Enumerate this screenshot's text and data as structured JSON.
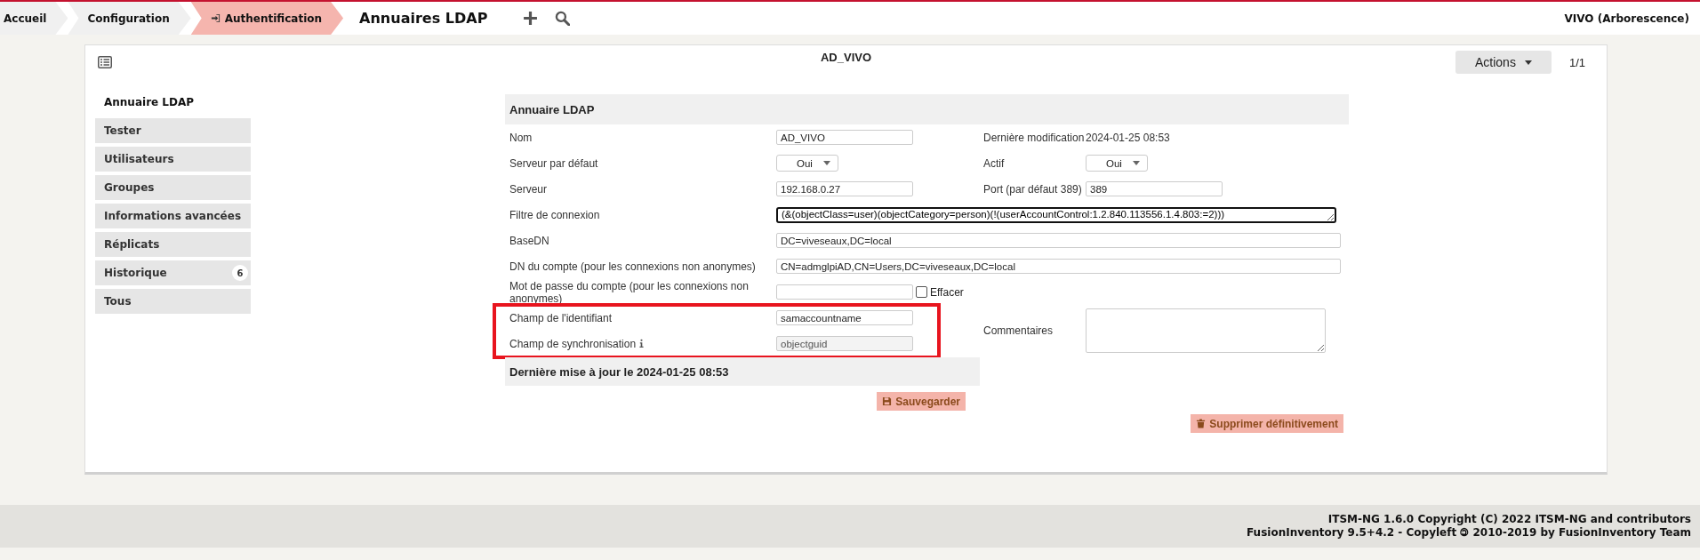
{
  "breadcrumbs": [
    {
      "label": "Accueil",
      "selected": false
    },
    {
      "label": "Configuration",
      "selected": false
    },
    {
      "label": "Authentification",
      "selected": true
    }
  ],
  "page_title": "Annuaires LDAP",
  "entity": "VIVO (Arborescence)",
  "card": {
    "title": "AD_VIVO",
    "actions_label": "Actions",
    "pager": "1/1"
  },
  "sidebar": [
    {
      "label": "Annuaire LDAP",
      "selected": true
    },
    {
      "label": "Tester",
      "selected": false
    },
    {
      "label": "Utilisateurs",
      "selected": false
    },
    {
      "label": "Groupes",
      "selected": false
    },
    {
      "label": "Informations avancées",
      "selected": false
    },
    {
      "label": "Réplicats",
      "selected": false
    },
    {
      "label": "Historique",
      "selected": false,
      "badge": "6"
    },
    {
      "label": "Tous",
      "selected": false
    }
  ],
  "form": {
    "header": "Annuaire LDAP",
    "rows": [
      {
        "left": {
          "label": "Nom",
          "kind": "text",
          "value": "AD_VIVO"
        },
        "right": {
          "label": "Dernière modification",
          "kind": "static",
          "value": "2024-01-25 08:53"
        }
      },
      {
        "left": {
          "label": "Serveur par défaut",
          "kind": "select",
          "value": "Oui"
        },
        "right": {
          "label": "Actif",
          "kind": "select",
          "value": "Oui"
        }
      },
      {
        "left": {
          "label": "Serveur",
          "kind": "text",
          "value": "192.168.0.27"
        },
        "right": {
          "label": "Port (par défaut 389)",
          "kind": "text",
          "value": "389"
        }
      },
      {
        "left": {
          "label": "Filtre de connexion",
          "kind": "textarea",
          "value": "(&(objectClass=user)(objectCategory=person)(!(userAccountControl:1.2.840.113556.1.4.803:=2)))"
        }
      },
      {
        "left": {
          "label": "BaseDN",
          "kind": "wide",
          "value": "DC=viveseaux,DC=local"
        }
      },
      {
        "left": {
          "label": "DN du compte (pour les connexions non anonymes)",
          "kind": "wide",
          "value": "CN=admglpiAD,CN=Users,DC=viveseaux,DC=local"
        }
      },
      {
        "left": {
          "label": "Mot de passe du compte (pour les connexions non anonymes)",
          "kind": "password",
          "checkbox": {
            "label": "Effacer",
            "checked": false
          }
        }
      }
    ],
    "highlighted_rows": [
      {
        "left": {
          "label": "Champ de l'identifiant",
          "kind": "text",
          "value": "samaccountname"
        },
        "right": {
          "label": "Commentaires",
          "kind": "comment"
        }
      },
      {
        "left": {
          "label": "Champ de synchronisation",
          "kind": "readonly",
          "value": "objectguid",
          "info": true
        }
      }
    ],
    "last_update": "Dernière mise à jour le 2024-01-25 08:53",
    "save_label": "Sauvegarder",
    "delete_label": "Supprimer définitivement"
  },
  "footer": [
    "ITSM-NG 1.6.0 Copyright (C) 2022 ITSM-NG and contributors",
    "FusionInventory 9.5+4.2 - Copyleft 🄯 2010-2019 by FusionInventory Team"
  ]
}
